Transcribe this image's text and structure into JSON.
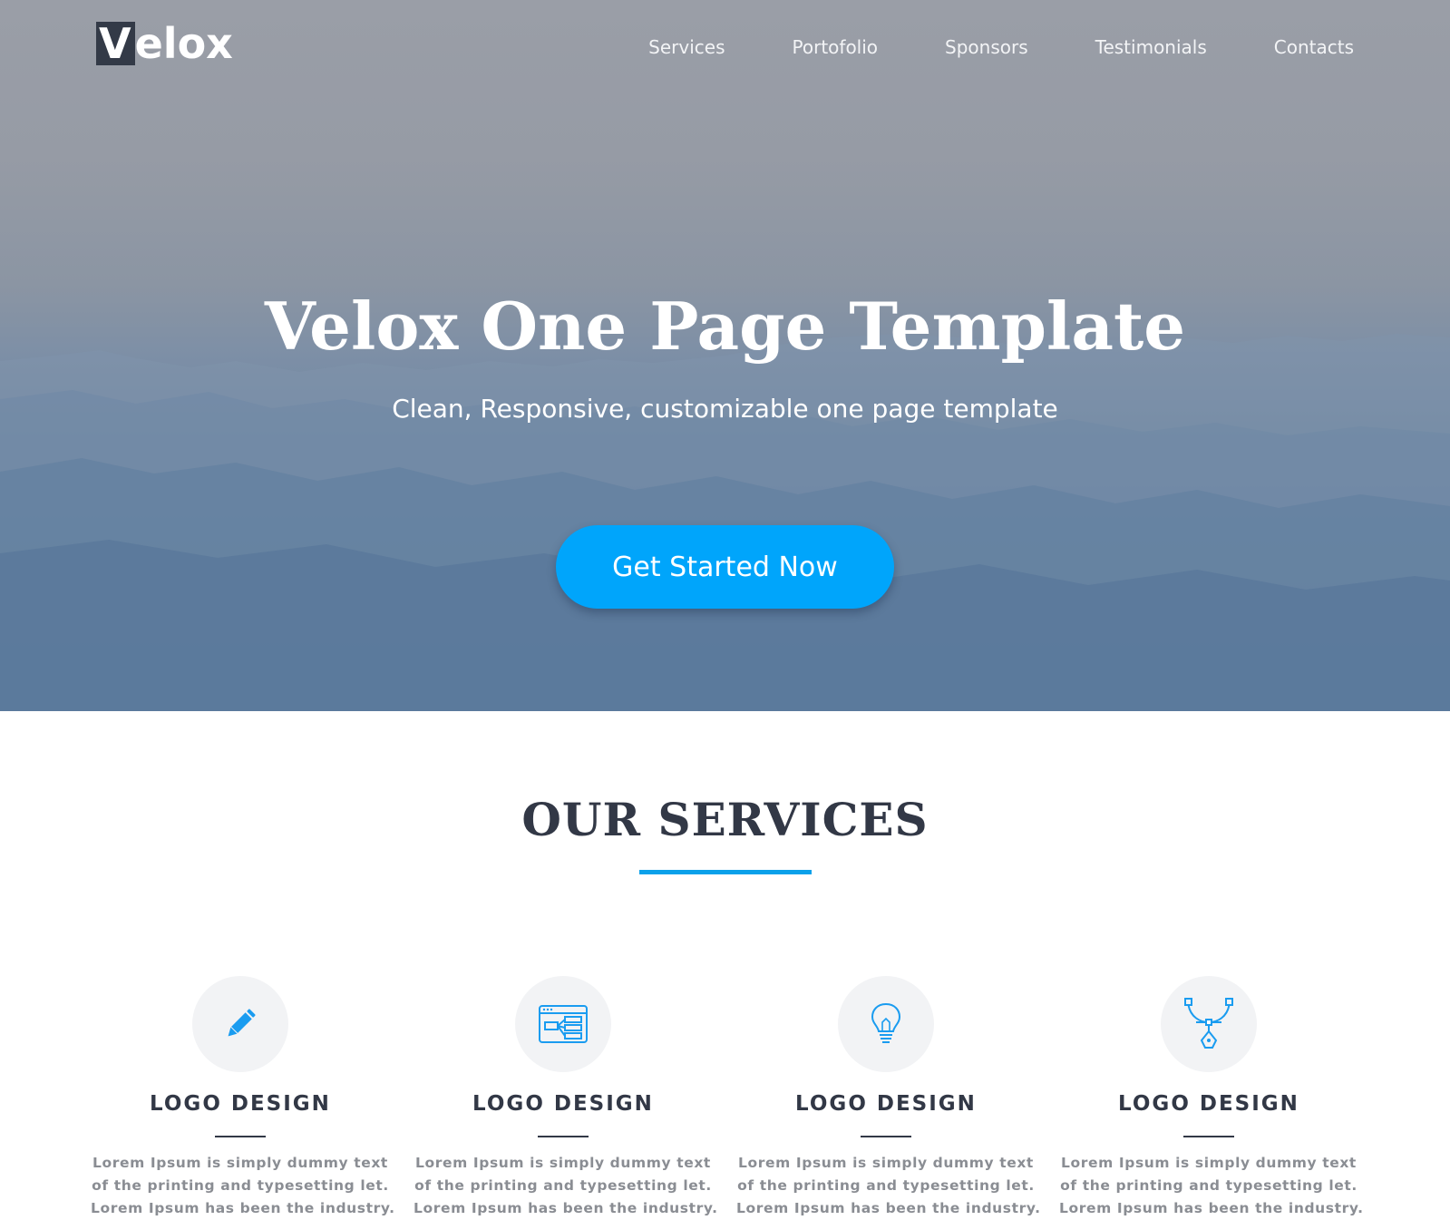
{
  "brand": {
    "logo_initial": "V",
    "logo_rest": "elox"
  },
  "nav": {
    "items": [
      {
        "label": "Services"
      },
      {
        "label": "Portofolio"
      },
      {
        "label": "Sponsors"
      },
      {
        "label": "Testimonials"
      },
      {
        "label": "Contacts"
      }
    ]
  },
  "hero": {
    "title": "Velox One Page Template",
    "subtitle": "Clean, Responsive, customizable one page template",
    "cta_label": "Get Started Now"
  },
  "services": {
    "heading": "OUR SERVICES",
    "cards": [
      {
        "icon": "pencil-icon",
        "title": "LOGO DESIGN",
        "lines": [
          "Lorem Ipsum is simply dummy text",
          "of the printing and typesetting let.",
          "Lorem Ipsum has been the industry."
        ]
      },
      {
        "icon": "sitemap-window-icon",
        "title": "LOGO DESIGN",
        "lines": [
          "Lorem Ipsum is simply dummy text",
          "of the printing and typesetting let.",
          "Lorem Ipsum has been the industry."
        ]
      },
      {
        "icon": "lightbulb-icon",
        "title": "LOGO DESIGN",
        "lines": [
          "Lorem Ipsum is simply dummy text",
          "of the printing and typesetting let.",
          "Lorem Ipsum has been the industry."
        ]
      },
      {
        "icon": "bezier-pen-icon",
        "title": "LOGO DESIGN",
        "lines": [
          "Lorem Ipsum is simply dummy text",
          "of the printing and typesetting let.",
          "Lorem Ipsum has been the industry."
        ]
      }
    ]
  },
  "colors": {
    "accent": "#00a5fb",
    "heading": "#323846",
    "body_text": "#8a8d93",
    "icon_bg": "#f2f3f5"
  }
}
